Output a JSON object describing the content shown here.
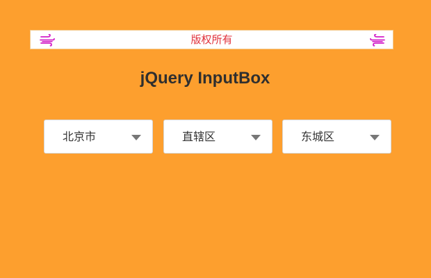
{
  "banner": {
    "text": "版权所有",
    "left_icon": "wind-icon",
    "right_icon": "wind-icon",
    "icon_color": "#d21fc8",
    "text_color": "#e0313c"
  },
  "page": {
    "title": "jQuery InputBox",
    "background": "#fd9f2e"
  },
  "selects": [
    {
      "value": "北京市",
      "icon": "chevron-down-icon"
    },
    {
      "value": "直辖区",
      "icon": "chevron-down-icon"
    },
    {
      "value": "东城区",
      "icon": "chevron-down-icon"
    }
  ]
}
